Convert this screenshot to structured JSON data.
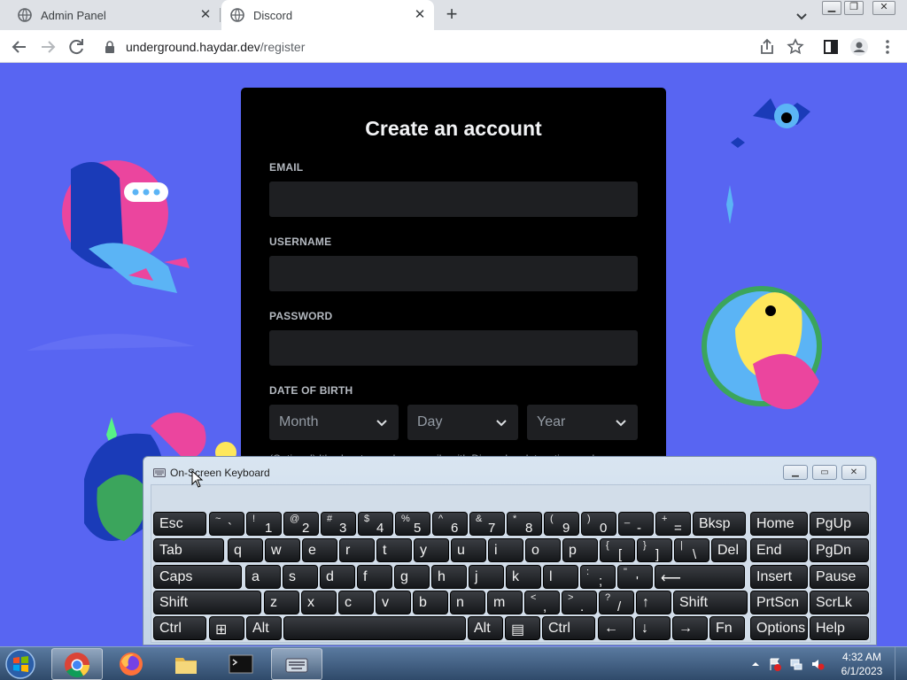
{
  "browser": {
    "tabs": [
      {
        "title": "Admin Panel",
        "active": false
      },
      {
        "title": "Discord",
        "active": true
      }
    ],
    "url": {
      "host": "underground.haydar.dev",
      "path": "/register"
    }
  },
  "form": {
    "title": "Create an account",
    "email_label": "EMAIL",
    "username_label": "USERNAME",
    "password_label": "PASSWORD",
    "dob_label": "DATE OF BIRTH",
    "month_placeholder": "Month",
    "day_placeholder": "Day",
    "year_placeholder": "Year",
    "optin_text": "(Optional) It's okay to send me emails with Discord updates, tips, and"
  },
  "osk": {
    "title": "On-Screen Keyboard",
    "rows": [
      [
        {
          "m": "Esc"
        },
        {
          "s": "~",
          "b": "`"
        },
        {
          "s": "!",
          "b": "1"
        },
        {
          "s": "@",
          "b": "2"
        },
        {
          "s": "#",
          "b": "3"
        },
        {
          "s": "$",
          "b": "4"
        },
        {
          "s": "%",
          "b": "5"
        },
        {
          "s": "^",
          "b": "6"
        },
        {
          "s": "&",
          "b": "7"
        },
        {
          "s": "*",
          "b": "8"
        },
        {
          "s": "(",
          "b": "9"
        },
        {
          "s": ")",
          "b": "0"
        },
        {
          "s": "_",
          "b": "-"
        },
        {
          "s": "+",
          "b": "="
        },
        {
          "m": "Bksp"
        },
        {
          "m": "Home"
        },
        {
          "m": "PgUp"
        }
      ],
      [
        {
          "m": "Tab"
        },
        {
          "m": "q"
        },
        {
          "m": "w"
        },
        {
          "m": "e"
        },
        {
          "m": "r"
        },
        {
          "m": "t"
        },
        {
          "m": "y"
        },
        {
          "m": "u"
        },
        {
          "m": "i"
        },
        {
          "m": "o"
        },
        {
          "m": "p"
        },
        {
          "s": "{",
          "b": "["
        },
        {
          "s": "}",
          "b": "]"
        },
        {
          "s": "|",
          "b": "\\"
        },
        {
          "m": "Del"
        },
        {
          "m": "End"
        },
        {
          "m": "PgDn"
        }
      ],
      [
        {
          "m": "Caps"
        },
        {
          "m": "a"
        },
        {
          "m": "s"
        },
        {
          "m": "d"
        },
        {
          "m": "f"
        },
        {
          "m": "g"
        },
        {
          "m": "h"
        },
        {
          "m": "j"
        },
        {
          "m": "k"
        },
        {
          "m": "l"
        },
        {
          "s": ":",
          "b": ";"
        },
        {
          "s": "\"",
          "b": "'"
        },
        {
          "m": "⟵"
        },
        {
          "m": "Insert"
        },
        {
          "m": "Pause"
        }
      ],
      [
        {
          "m": "Shift"
        },
        {
          "m": "z"
        },
        {
          "m": "x"
        },
        {
          "m": "c"
        },
        {
          "m": "v"
        },
        {
          "m": "b"
        },
        {
          "m": "n"
        },
        {
          "m": "m"
        },
        {
          "s": "<",
          "b": ","
        },
        {
          "s": ">",
          "b": "."
        },
        {
          "s": "?",
          "b": "/"
        },
        {
          "m": "↑"
        },
        {
          "m": "Shift"
        },
        {
          "m": "PrtScn"
        },
        {
          "m": "ScrLk"
        }
      ],
      [
        {
          "m": "Ctrl"
        },
        {
          "m": "⊞"
        },
        {
          "m": "Alt"
        },
        {
          "m": ""
        },
        {
          "m": "Alt"
        },
        {
          "m": "▤"
        },
        {
          "m": "Ctrl"
        },
        {
          "m": "←"
        },
        {
          "m": "↓"
        },
        {
          "m": "→"
        },
        {
          "m": "Fn"
        },
        {
          "m": "Options"
        },
        {
          "m": "Help"
        }
      ]
    ]
  },
  "taskbar": {
    "time": "4:32 AM",
    "date": "6/1/2023"
  },
  "colors": {
    "brand": "#5865f2",
    "card": "#000000",
    "input": "#1e1f22"
  }
}
